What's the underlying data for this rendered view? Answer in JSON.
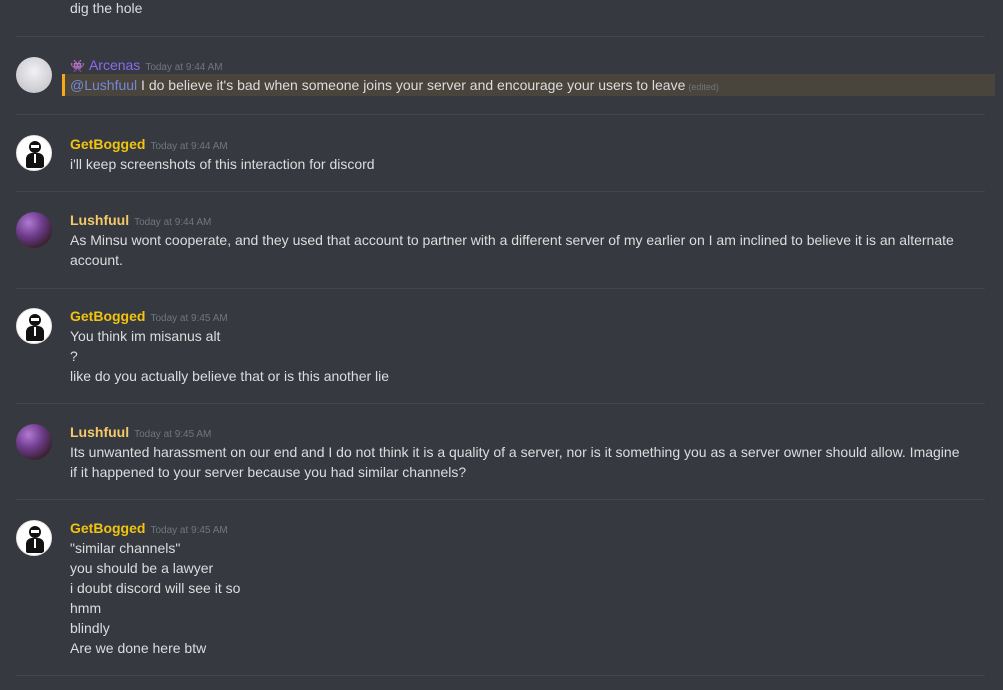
{
  "top_message": "dig the hole",
  "messages": [
    {
      "author": "Arcenas",
      "timestamp": "Today at 9:44 AM",
      "mention": "@Lushfuul",
      "text": " I do believe it's bad when someone joins your server and encourage your users to leave",
      "edited": "(edited)"
    },
    {
      "author": "GetBogged",
      "timestamp": "Today at 9:44 AM",
      "lines": [
        "i'll keep screenshots of this interaction for discord"
      ]
    },
    {
      "author": "Lushfuul",
      "timestamp": "Today at 9:44 AM",
      "lines": [
        "As Minsu wont cooperate, and they used that account to partner with a different server of my earlier on I am inclined to believe it is an alternate account."
      ]
    },
    {
      "author": "GetBogged",
      "timestamp": "Today at 9:45 AM",
      "lines": [
        "You think im misanus alt",
        "?",
        "like do you actually believe that or is this another lie"
      ]
    },
    {
      "author": "Lushfuul",
      "timestamp": "Today at 9:45 AM",
      "lines": [
        "Its unwanted harassment on our end and I do not think it is a quality of a server, nor is it something you as a server owner should allow. Imagine if it happened to your server because you had similar channels?"
      ]
    },
    {
      "author": "GetBogged",
      "timestamp": "Today at 9:45 AM",
      "lines": [
        "\"similar channels\"",
        "you should be a lawyer",
        "i doubt discord will see it so",
        "hmm",
        "blindly",
        "Are we done here btw"
      ]
    }
  ],
  "colors": {
    "background": "#36393f",
    "mention_highlight": "#49443c",
    "mention_bar": "#faa61a",
    "getbogged_name": "#f1c40f",
    "lushfuul_name": "#f5c96a",
    "arcenas_name": "#8a6bf0"
  },
  "icons": {
    "bot_badge": "alien-monster-icon"
  }
}
